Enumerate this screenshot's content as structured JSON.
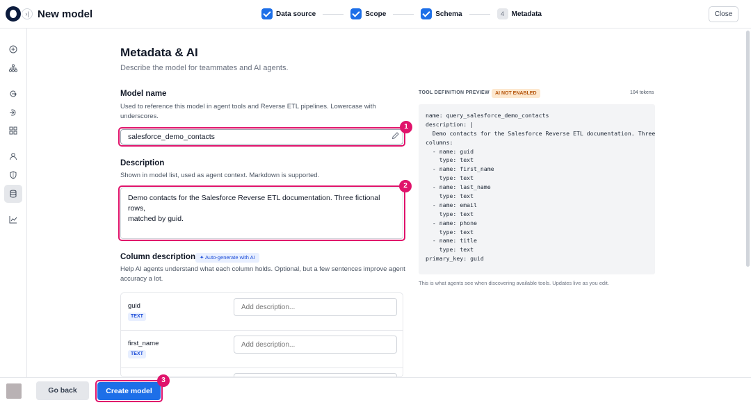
{
  "header": {
    "title": "New model",
    "close_label": "Close",
    "steps": [
      {
        "label": "Data source",
        "state": "done"
      },
      {
        "label": "Scope",
        "state": "done"
      },
      {
        "label": "Schema",
        "state": "done"
      },
      {
        "number": "4",
        "label": "Metadata",
        "state": "current"
      }
    ]
  },
  "sidebar": {
    "icons": [
      "add-circle-icon",
      "hierarchy-icon",
      "sync-icon",
      "import-icon",
      "grid-icon",
      "user-icon",
      "shield-icon",
      "database-icon",
      "chart-icon"
    ],
    "active": "database-icon"
  },
  "main": {
    "title": "Metadata & AI",
    "subtitle": "Describe the model for teammates and AI agents.",
    "model_name": {
      "label": "Model name",
      "help_line1": "Used to reference this model in agent tools and Reverse ETL pipelines. Lowercase with",
      "help_line2": "underscores.",
      "value": "salesforce_demo_contacts"
    },
    "description": {
      "label": "Description",
      "help": "Shown in model list, used as agent context. Markdown is supported.",
      "value_line1": "Demo contacts for the Salesforce Reverse ETL documentation. Three fictional rows,",
      "value_line2": "matched by guid."
    },
    "column_descriptions": {
      "label": "Column descriptions",
      "autogen_label": "✦ Auto-generate with AI",
      "help_line1": "Help AI agents understand what each column holds. Optional, but a few sentences improve agent",
      "help_line2": "accuracy a lot.",
      "placeholder": "Add description...",
      "columns": [
        {
          "name": "guid",
          "type": "TEXT"
        },
        {
          "name": "first_name",
          "type": "TEXT"
        }
      ]
    }
  },
  "preview": {
    "label": "TOOL DEFINITION PREVIEW",
    "ai_badge": "AI NOT ENABLED",
    "tokens": "104 tokens",
    "code": [
      "name: query_salesforce_demo_contacts",
      "description: |",
      "  Demo contacts for the Salesforce Reverse ETL documentation. Three fictional rows,",
      "columns:",
      "  - name: guid",
      "    type: text",
      "  - name: first_name",
      "    type: text",
      "  - name: last_name",
      "    type: text",
      "  - name: email",
      "    type: text",
      "  - name: phone",
      "    type: text",
      "  - name: title",
      "    type: text",
      "primary_key: guid"
    ],
    "note": "This is what agents see when discovering available tools. Updates live as you edit."
  },
  "footer": {
    "back_label": "Go back",
    "create_label": "Create model"
  },
  "markers": [
    "1",
    "2",
    "3"
  ],
  "colors": {
    "accent": "#1d6fe8",
    "highlight": "#e0136b",
    "ai_badge_bg": "#fde8cf"
  }
}
